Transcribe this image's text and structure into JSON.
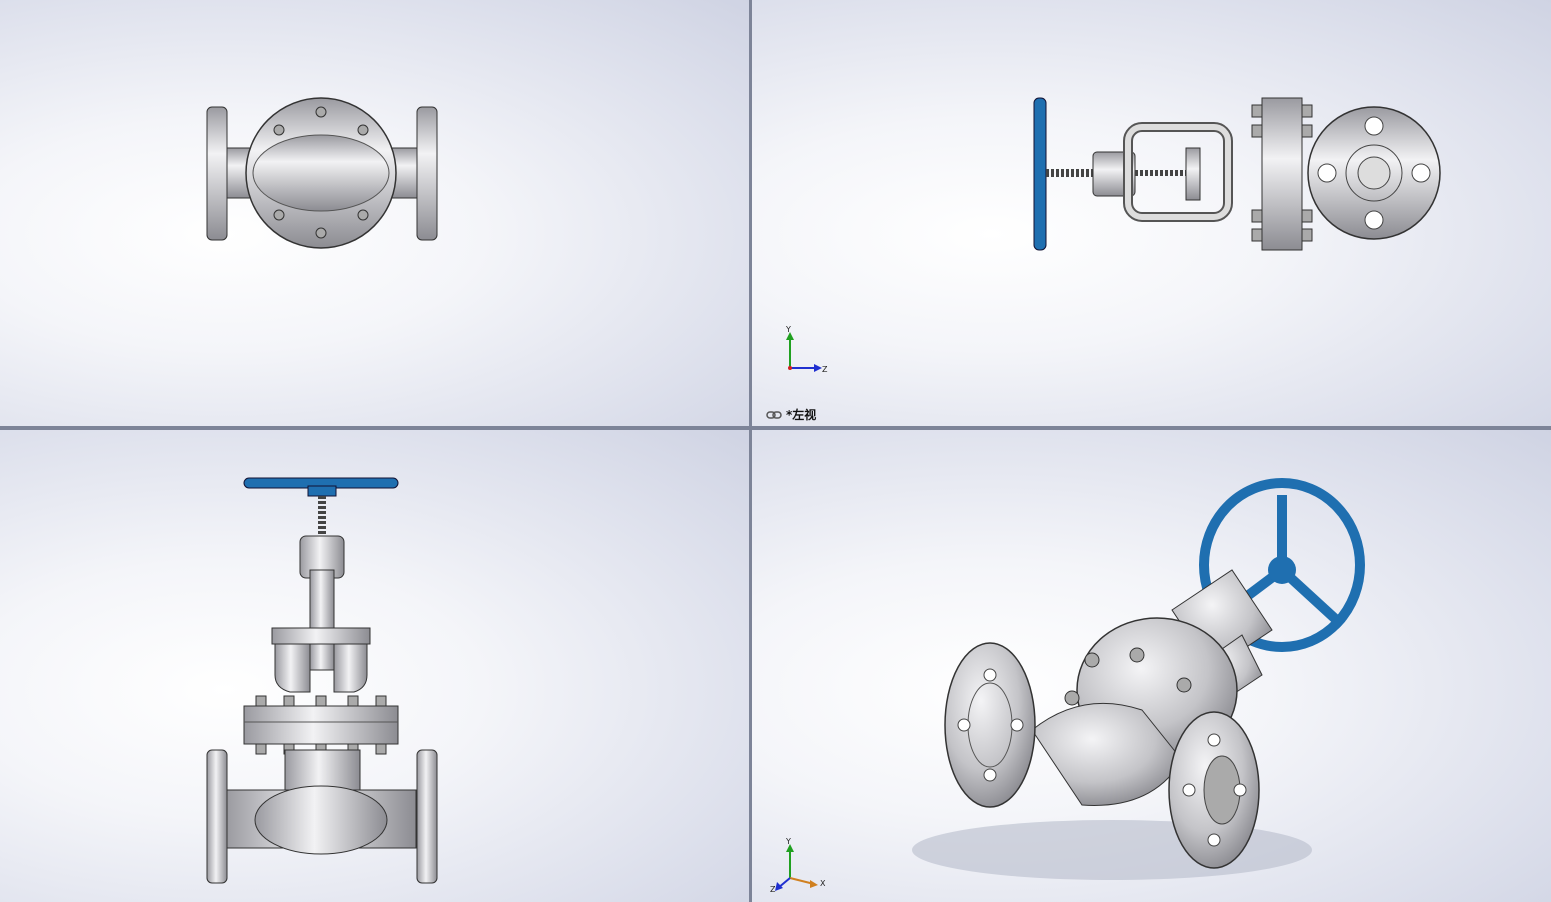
{
  "viewports": {
    "top_right": {
      "view_label": "*左视"
    }
  },
  "triads": {
    "left_view": {
      "y": "Y",
      "z": "Z"
    },
    "iso_view": {
      "y": "Y",
      "z": "Z",
      "x": "X"
    }
  },
  "colors": {
    "background_light": "#ffffff",
    "background_shade": "#cfd3e3",
    "divider": "#7d8498",
    "metal": "#c8c8cc",
    "handwheel": "#1f6fb0",
    "axis_x": "#d02020",
    "axis_y": "#20a020",
    "axis_z": "#2030d0"
  }
}
